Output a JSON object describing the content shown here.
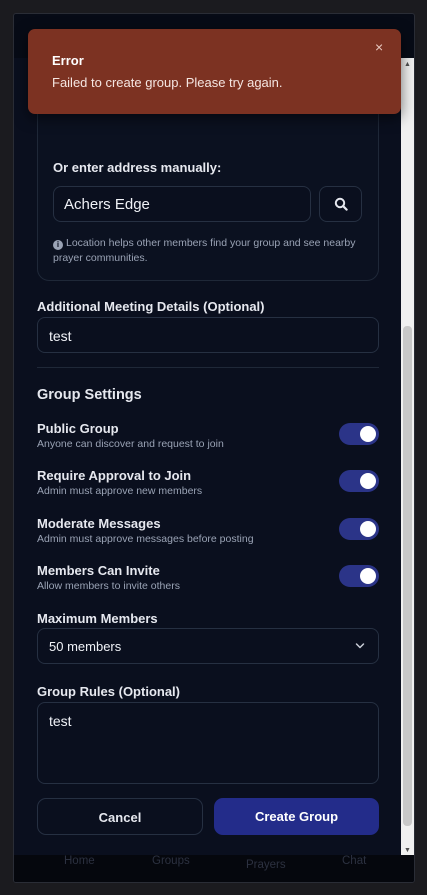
{
  "location": {
    "manual_label": "Or enter address manually:",
    "address_value": "Achers Edge",
    "help_text": "Location helps other members find your group and see nearby prayer communities."
  },
  "meeting": {
    "label": "Additional Meeting Details (Optional)",
    "value": "test"
  },
  "settings": {
    "title": "Group Settings",
    "items": [
      {
        "title": "Public Group",
        "desc": "Anyone can discover and request to join",
        "enabled": true
      },
      {
        "title": "Require Approval to Join",
        "desc": "Admin must approve new members",
        "enabled": true
      },
      {
        "title": "Moderate Messages",
        "desc": "Admin must approve messages before posting",
        "enabled": true
      },
      {
        "title": "Members Can Invite",
        "desc": "Allow members to invite others",
        "enabled": true
      }
    ]
  },
  "max_members": {
    "label": "Maximum Members",
    "selected": "50 members"
  },
  "rules": {
    "label": "Group Rules (Optional)",
    "value": "test"
  },
  "actions": {
    "cancel": "Cancel",
    "create": "Create Group"
  },
  "nav": {
    "home": "Home",
    "groups": "Groups",
    "prayers": "Prayers",
    "chat": "Chat"
  },
  "toast": {
    "title": "Error",
    "message": "Failed to create group. Please try again.",
    "close": "×"
  },
  "colors": {
    "accent": "#232c8a",
    "toggle_on": "#2b3488",
    "error_bg": "#7c3222",
    "page_bg": "#0a0f1e"
  }
}
